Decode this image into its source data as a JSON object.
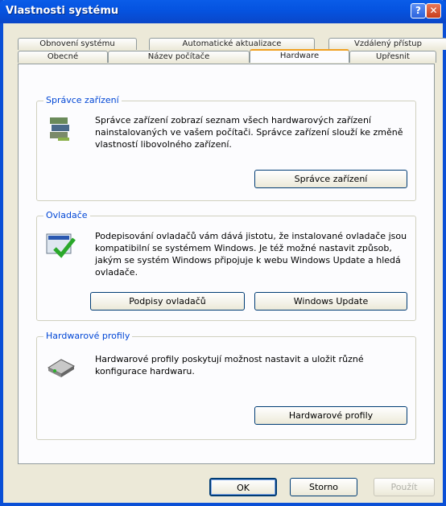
{
  "window": {
    "title": "Vlastnosti systému"
  },
  "tabs": {
    "row1": [
      "Obnovení systému",
      "Automatické aktualizace",
      "Vzdálený přístup"
    ],
    "row2": [
      "Obecné",
      "Název počítače",
      "Hardware",
      "Upřesnit"
    ],
    "active": "Hardware"
  },
  "device_manager": {
    "legend": "Správce zařízení",
    "text": "Správce zařízení zobrazí seznam všech hardwarových zařízení nainstalovaných ve vašem počítači. Správce zařízení slouží ke změně vlastností libovolného zařízení.",
    "button": "Správce zařízení"
  },
  "drivers": {
    "legend": "Ovladače",
    "text": "Podepisování ovladačů vám dává jistotu, že instalované ovladače jsou kompatibilní se systémem Windows. Je též možné nastavit způsob, jakým se systém Windows připojuje k webu Windows Update a hledá ovladače.",
    "button_signing": "Podpisy ovladačů",
    "button_update": "Windows Update"
  },
  "hw_profiles": {
    "legend": "Hardwarové profily",
    "text": "Hardwarové profily poskytují možnost nastavit a uložit různé konfigurace hardwaru.",
    "button": "Hardwarové profily"
  },
  "footer": {
    "ok": "OK",
    "cancel": "Storno",
    "apply": "Použít"
  }
}
